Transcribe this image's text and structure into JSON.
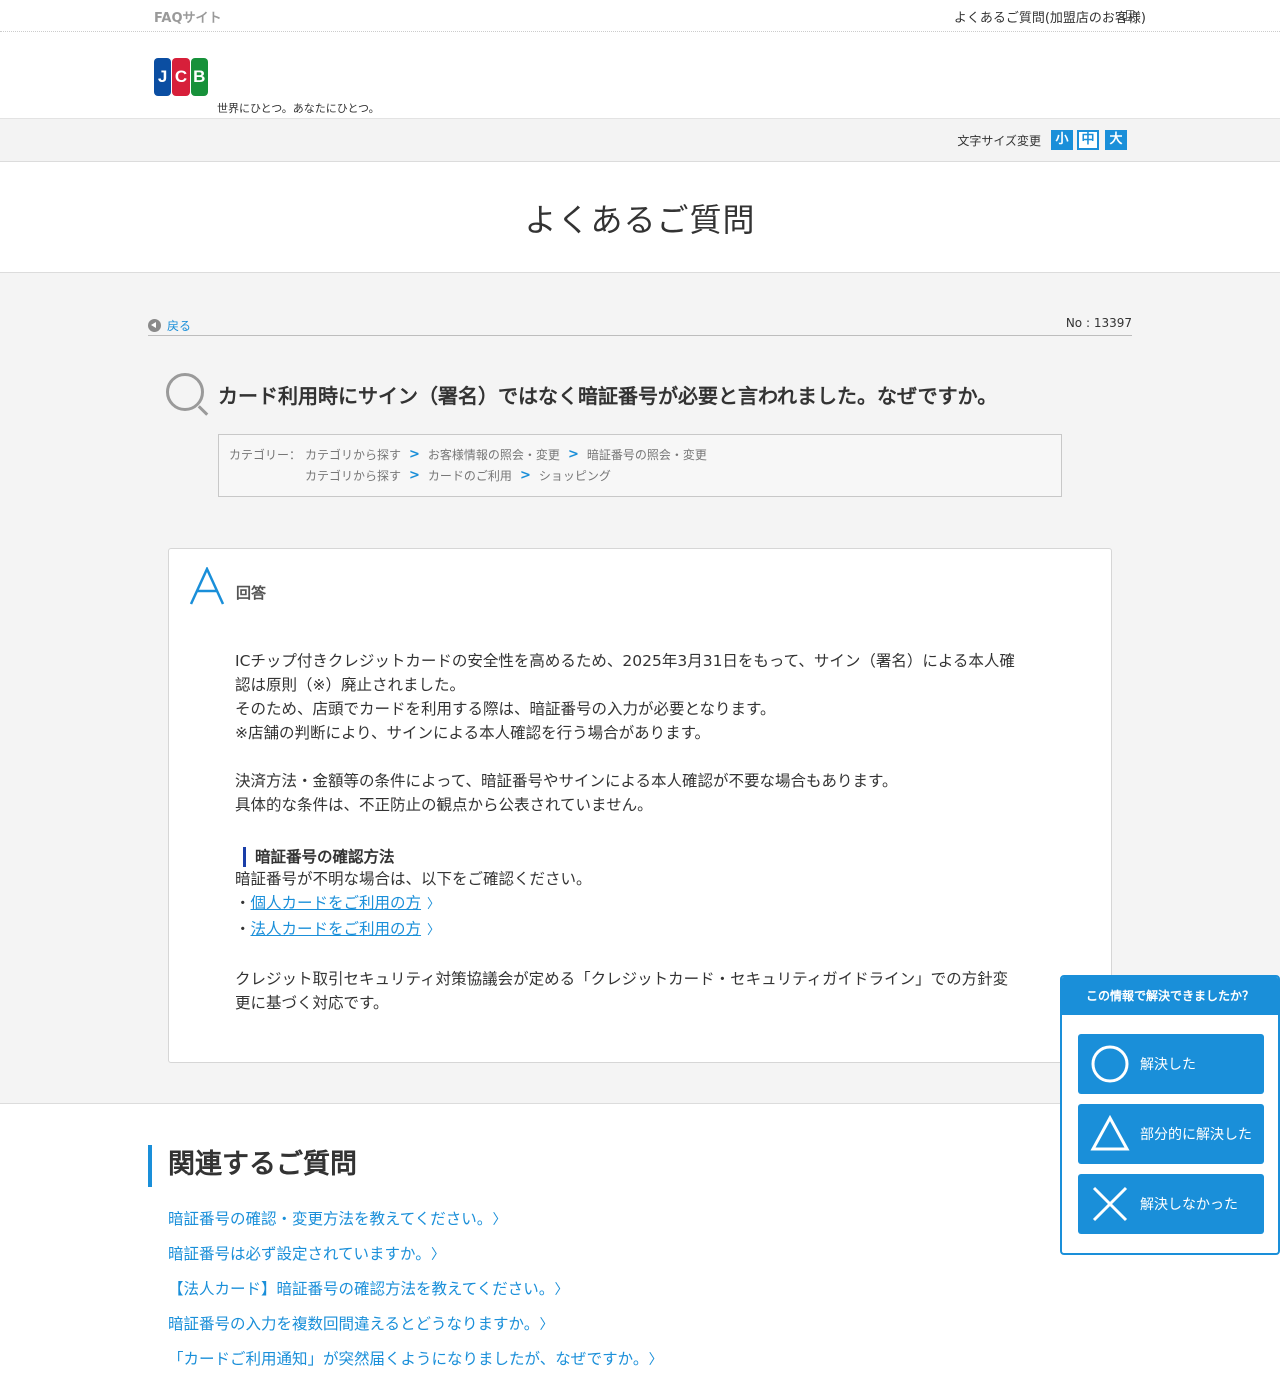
{
  "topbar": {
    "faq_site": "FAQサイト",
    "merchant_link": "よくあるご質問(加盟店のお客様)"
  },
  "header": {
    "logo_letters": [
      "J",
      "C",
      "B"
    ],
    "tagline": "世界にひとつ。あなたにひとつ。"
  },
  "fontsize": {
    "label": "文字サイズ変更",
    "small": "小",
    "medium": "中",
    "large": "大"
  },
  "page_title": "よくあるご質問",
  "nav": {
    "back": "戻る",
    "question_number": "No : 13397"
  },
  "question": {
    "title": "カード利用時にサイン（署名）ではなく暗証番号が必要と言われました。なぜですか。"
  },
  "categories": {
    "label": "カテゴリー：",
    "path1": [
      "カテゴリから探す",
      "お客様情報の照会・変更",
      "暗証番号の照会・変更"
    ],
    "path2": [
      "カテゴリから探す",
      "カードのご利用",
      "ショッピング"
    ],
    "separator": ">"
  },
  "answer": {
    "label": "回答",
    "para1_line1": "ICチップ付きクレジットカードの安全性を高めるため、2025年3月31日をもって、サイン（署名）による本人確",
    "para1_line2": "認は原則（※）廃止されました。",
    "para1_line3": "そのため、店頭でカードを利用する際は、暗証番号の入力が必要となります。",
    "para1_line4": "※店舗の判断により、サインによる本人確認を行う場合があります。",
    "para2_line1": "決済方法・金額等の条件によって、暗証番号やサインによる本人確認が不要な場合もあります。",
    "para2_line2": "具体的な条件は、不正防止の観点から公表されていません。",
    "subheading": "暗証番号の確認方法",
    "sub_intro": "暗証番号が不明な場合は、以下をご確認ください。",
    "bullet": "・",
    "link_personal": "個人カードをご利用の方",
    "link_corporate": "法人カードをご利用の方",
    "para3_line1": "クレジット取引セキュリティ対策協議会が定める「クレジットカード・セキュリティガイドライン」での方針変",
    "para3_line2": "更に基づく対応です。"
  },
  "related": {
    "title": "関連するご質問",
    "items": [
      "暗証番号の確認・変更方法を教えてください。",
      "暗証番号は必ず設定されていますか。",
      "【法人カード】暗証番号の確認方法を教えてください。",
      "暗証番号の入力を複数回間違えるとどうなりますか。",
      "「カードご利用通知」が突然届くようになりましたが、なぜですか。"
    ]
  },
  "feedback": {
    "heading": "この情報で解決できましたか？",
    "resolved": "解決した",
    "partial": "部分的に解決した",
    "unresolved": "解決しなかった"
  },
  "colors": {
    "accent": "#1a8fd9",
    "jcb_blue": "#0b4ea2",
    "jcb_red": "#d71f3a",
    "jcb_green": "#17913a",
    "background_gray": "#f4f4f4"
  }
}
